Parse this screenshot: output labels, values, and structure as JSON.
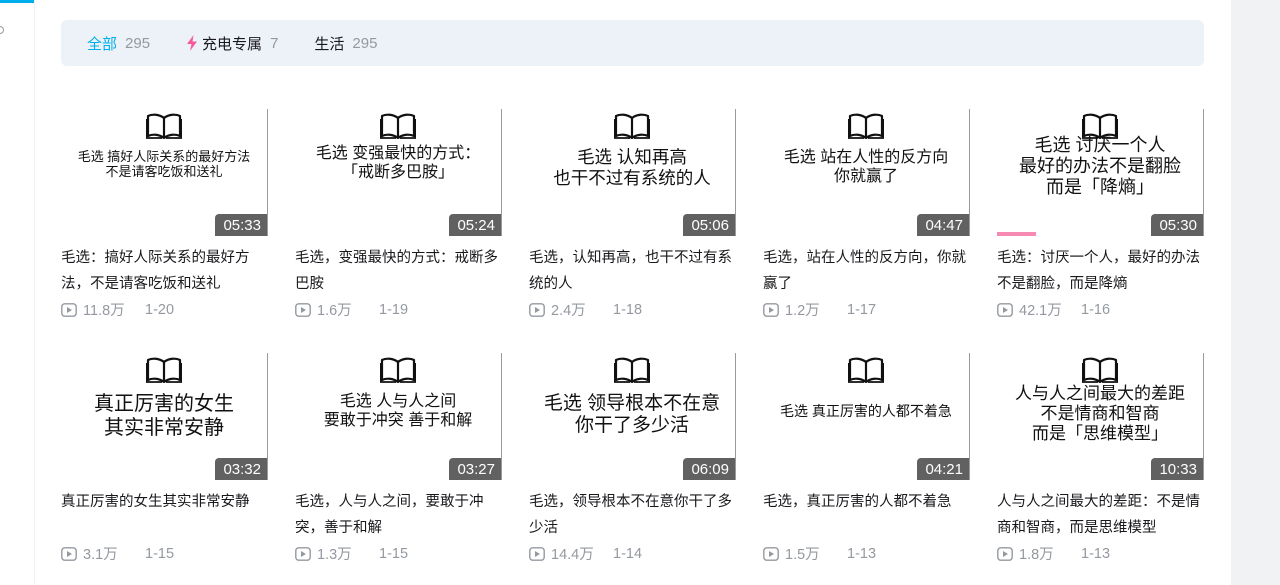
{
  "filters": [
    {
      "label": "全部",
      "count": "295",
      "active": true
    },
    {
      "label": "充电专属",
      "count": "7",
      "icon": "lightning-icon",
      "icon_color": "#f7599b"
    },
    {
      "label": "生活",
      "count": "295"
    }
  ],
  "colors": {
    "accent": "#00aeec",
    "filter_bar_bg": "#edf2f8",
    "muted": "#9499a0",
    "progress": "#f78ab2"
  },
  "videos": [
    {
      "cover": "毛选  搞好人际关系的最好方法\n不是请客吃饭和送礼",
      "duration": "05:33",
      "title": "毛选：搞好人际关系的最好方法，不是请客吃饭和送礼",
      "views": "11.8万",
      "date": "1-20"
    },
    {
      "cover": "毛选  变强最快的方式：\n「戒断多巴胺」",
      "duration": "05:24",
      "title": "毛选，变强最快的方式：戒断多巴胺",
      "views": "1.6万",
      "date": "1-19"
    },
    {
      "cover": "毛选  认知再高\n也干不过有系统的人",
      "duration": "05:06",
      "title": "毛选，认知再高，也干不过有系统的人",
      "views": "2.4万",
      "date": "1-18"
    },
    {
      "cover": "毛选  站在人性的反方向\n你就赢了",
      "duration": "04:47",
      "title": "毛选，站在人性的反方向，你就赢了",
      "views": "1.2万",
      "date": "1-17"
    },
    {
      "cover": "毛选  讨厌一个人\n最好的办法不是翻脸\n而是「降熵」",
      "duration": "05:30",
      "title": "毛选：讨厌一个人，最好的办法不是翻脸，而是降熵",
      "views": "42.1万",
      "date": "1-16",
      "watch_progress": 0.19
    },
    {
      "cover": "真正厉害的女生\n其实非常安静",
      "duration": "03:32",
      "title": "真正厉害的女生其实非常安静",
      "views": "3.1万",
      "date": "1-15"
    },
    {
      "cover": "毛选  人与人之间\n要敢于冲突  善于和解",
      "duration": "03:27",
      "title": "毛选，人与人之间，要敢于冲突，善于和解",
      "views": "1.3万",
      "date": "1-15"
    },
    {
      "cover": "毛选  领导根本不在意\n你干了多少活",
      "duration": "06:09",
      "title": "毛选，领导根本不在意你干了多少活",
      "views": "14.4万",
      "date": "1-14"
    },
    {
      "cover": "毛选  真正厉害的人都不着急",
      "duration": "04:21",
      "title": "毛选，真正厉害的人都不着急",
      "views": "1.5万",
      "date": "1-13"
    },
    {
      "cover": "人与人之间最大的差距\n不是情商和智商\n而是「思维模型」",
      "duration": "10:33",
      "title": "人与人之间最大的差距：不是情商和智商，而是思维模型",
      "views": "1.8万",
      "date": "1-13"
    }
  ]
}
